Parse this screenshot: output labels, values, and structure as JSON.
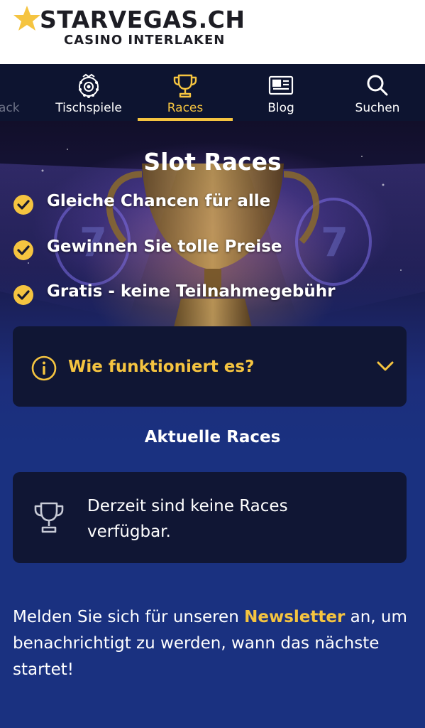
{
  "header": {
    "brand": "STARVEGAS.CH",
    "subtitle": "CASINO INTERLAKEN"
  },
  "nav": {
    "partial_label": "ack",
    "items": [
      {
        "label": "Tischspiele",
        "icon": "roulette-wheel-icon",
        "active": false
      },
      {
        "label": "Races",
        "icon": "trophy-icon",
        "active": true
      },
      {
        "label": "Blog",
        "icon": "newspaper-icon",
        "active": false
      },
      {
        "label": "Suchen",
        "icon": "search-icon",
        "active": false
      }
    ]
  },
  "hero": {
    "title": "Slot Races",
    "features": [
      "Gleiche Chancen für alle",
      "Gewinnen Sie tolle Preise",
      "Gratis - keine Teilnahmegebühr"
    ]
  },
  "accordion": {
    "label": "Wie funktioniert es?"
  },
  "current": {
    "title": "Aktuelle Races",
    "empty_message": "Derzeit sind keine Races verfügbar."
  },
  "newsletter": {
    "before": "Melden Sie sich für unseren ",
    "link": "Newsletter",
    "after": " an, um benachrichtigt zu werden, wann das nächste startet!"
  },
  "colors": {
    "accent": "#f5c440",
    "background": "#1a3180",
    "card": "#101634",
    "nav": "#0d1430"
  }
}
